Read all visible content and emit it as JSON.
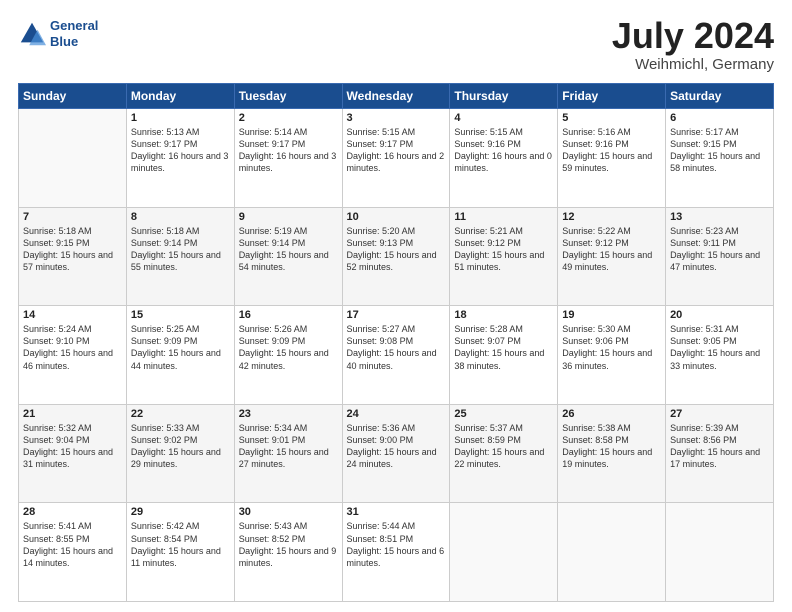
{
  "logo": {
    "line1": "General",
    "line2": "Blue"
  },
  "title": {
    "month_year": "July 2024",
    "location": "Weihmichl, Germany"
  },
  "weekdays": [
    "Sunday",
    "Monday",
    "Tuesday",
    "Wednesday",
    "Thursday",
    "Friday",
    "Saturday"
  ],
  "weeks": [
    [
      {
        "num": "",
        "sunrise": "",
        "sunset": "",
        "daylight": ""
      },
      {
        "num": "1",
        "sunrise": "Sunrise: 5:13 AM",
        "sunset": "Sunset: 9:17 PM",
        "daylight": "Daylight: 16 hours and 3 minutes."
      },
      {
        "num": "2",
        "sunrise": "Sunrise: 5:14 AM",
        "sunset": "Sunset: 9:17 PM",
        "daylight": "Daylight: 16 hours and 3 minutes."
      },
      {
        "num": "3",
        "sunrise": "Sunrise: 5:15 AM",
        "sunset": "Sunset: 9:17 PM",
        "daylight": "Daylight: 16 hours and 2 minutes."
      },
      {
        "num": "4",
        "sunrise": "Sunrise: 5:15 AM",
        "sunset": "Sunset: 9:16 PM",
        "daylight": "Daylight: 16 hours and 0 minutes."
      },
      {
        "num": "5",
        "sunrise": "Sunrise: 5:16 AM",
        "sunset": "Sunset: 9:16 PM",
        "daylight": "Daylight: 15 hours and 59 minutes."
      },
      {
        "num": "6",
        "sunrise": "Sunrise: 5:17 AM",
        "sunset": "Sunset: 9:15 PM",
        "daylight": "Daylight: 15 hours and 58 minutes."
      }
    ],
    [
      {
        "num": "7",
        "sunrise": "Sunrise: 5:18 AM",
        "sunset": "Sunset: 9:15 PM",
        "daylight": "Daylight: 15 hours and 57 minutes."
      },
      {
        "num": "8",
        "sunrise": "Sunrise: 5:18 AM",
        "sunset": "Sunset: 9:14 PM",
        "daylight": "Daylight: 15 hours and 55 minutes."
      },
      {
        "num": "9",
        "sunrise": "Sunrise: 5:19 AM",
        "sunset": "Sunset: 9:14 PM",
        "daylight": "Daylight: 15 hours and 54 minutes."
      },
      {
        "num": "10",
        "sunrise": "Sunrise: 5:20 AM",
        "sunset": "Sunset: 9:13 PM",
        "daylight": "Daylight: 15 hours and 52 minutes."
      },
      {
        "num": "11",
        "sunrise": "Sunrise: 5:21 AM",
        "sunset": "Sunset: 9:12 PM",
        "daylight": "Daylight: 15 hours and 51 minutes."
      },
      {
        "num": "12",
        "sunrise": "Sunrise: 5:22 AM",
        "sunset": "Sunset: 9:12 PM",
        "daylight": "Daylight: 15 hours and 49 minutes."
      },
      {
        "num": "13",
        "sunrise": "Sunrise: 5:23 AM",
        "sunset": "Sunset: 9:11 PM",
        "daylight": "Daylight: 15 hours and 47 minutes."
      }
    ],
    [
      {
        "num": "14",
        "sunrise": "Sunrise: 5:24 AM",
        "sunset": "Sunset: 9:10 PM",
        "daylight": "Daylight: 15 hours and 46 minutes."
      },
      {
        "num": "15",
        "sunrise": "Sunrise: 5:25 AM",
        "sunset": "Sunset: 9:09 PM",
        "daylight": "Daylight: 15 hours and 44 minutes."
      },
      {
        "num": "16",
        "sunrise": "Sunrise: 5:26 AM",
        "sunset": "Sunset: 9:09 PM",
        "daylight": "Daylight: 15 hours and 42 minutes."
      },
      {
        "num": "17",
        "sunrise": "Sunrise: 5:27 AM",
        "sunset": "Sunset: 9:08 PM",
        "daylight": "Daylight: 15 hours and 40 minutes."
      },
      {
        "num": "18",
        "sunrise": "Sunrise: 5:28 AM",
        "sunset": "Sunset: 9:07 PM",
        "daylight": "Daylight: 15 hours and 38 minutes."
      },
      {
        "num": "19",
        "sunrise": "Sunrise: 5:30 AM",
        "sunset": "Sunset: 9:06 PM",
        "daylight": "Daylight: 15 hours and 36 minutes."
      },
      {
        "num": "20",
        "sunrise": "Sunrise: 5:31 AM",
        "sunset": "Sunset: 9:05 PM",
        "daylight": "Daylight: 15 hours and 33 minutes."
      }
    ],
    [
      {
        "num": "21",
        "sunrise": "Sunrise: 5:32 AM",
        "sunset": "Sunset: 9:04 PM",
        "daylight": "Daylight: 15 hours and 31 minutes."
      },
      {
        "num": "22",
        "sunrise": "Sunrise: 5:33 AM",
        "sunset": "Sunset: 9:02 PM",
        "daylight": "Daylight: 15 hours and 29 minutes."
      },
      {
        "num": "23",
        "sunrise": "Sunrise: 5:34 AM",
        "sunset": "Sunset: 9:01 PM",
        "daylight": "Daylight: 15 hours and 27 minutes."
      },
      {
        "num": "24",
        "sunrise": "Sunrise: 5:36 AM",
        "sunset": "Sunset: 9:00 PM",
        "daylight": "Daylight: 15 hours and 24 minutes."
      },
      {
        "num": "25",
        "sunrise": "Sunrise: 5:37 AM",
        "sunset": "Sunset: 8:59 PM",
        "daylight": "Daylight: 15 hours and 22 minutes."
      },
      {
        "num": "26",
        "sunrise": "Sunrise: 5:38 AM",
        "sunset": "Sunset: 8:58 PM",
        "daylight": "Daylight: 15 hours and 19 minutes."
      },
      {
        "num": "27",
        "sunrise": "Sunrise: 5:39 AM",
        "sunset": "Sunset: 8:56 PM",
        "daylight": "Daylight: 15 hours and 17 minutes."
      }
    ],
    [
      {
        "num": "28",
        "sunrise": "Sunrise: 5:41 AM",
        "sunset": "Sunset: 8:55 PM",
        "daylight": "Daylight: 15 hours and 14 minutes."
      },
      {
        "num": "29",
        "sunrise": "Sunrise: 5:42 AM",
        "sunset": "Sunset: 8:54 PM",
        "daylight": "Daylight: 15 hours and 11 minutes."
      },
      {
        "num": "30",
        "sunrise": "Sunrise: 5:43 AM",
        "sunset": "Sunset: 8:52 PM",
        "daylight": "Daylight: 15 hours and 9 minutes."
      },
      {
        "num": "31",
        "sunrise": "Sunrise: 5:44 AM",
        "sunset": "Sunset: 8:51 PM",
        "daylight": "Daylight: 15 hours and 6 minutes."
      },
      {
        "num": "",
        "sunrise": "",
        "sunset": "",
        "daylight": ""
      },
      {
        "num": "",
        "sunrise": "",
        "sunset": "",
        "daylight": ""
      },
      {
        "num": "",
        "sunrise": "",
        "sunset": "",
        "daylight": ""
      }
    ]
  ]
}
